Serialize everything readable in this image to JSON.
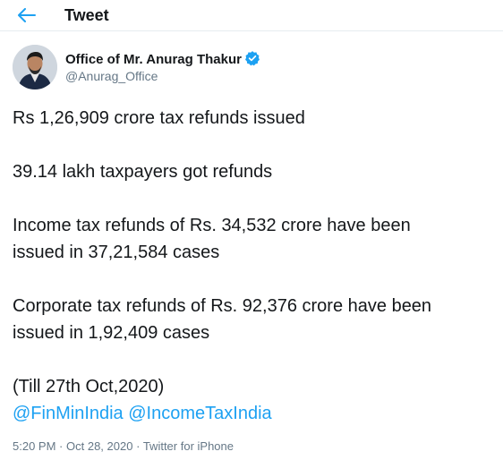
{
  "header": {
    "title": "Tweet",
    "back_icon": "arrow-left-icon",
    "accent_color": "#1da1f2"
  },
  "author": {
    "name": "Office of Mr. Anurag Thakur",
    "handle": "@Anurag_Office",
    "verified_icon": "verified-badge-icon"
  },
  "tweet": {
    "line1": "Rs 1,26,909 crore tax refunds issued",
    "line2": "39.14 lakh taxpayers got refunds",
    "line3a": "Income tax refunds of Rs. 34,532 crore have been",
    "line3b": "issued in 37,21,584 cases",
    "line4a": "Corporate tax refunds of Rs. 92,376 crore have been",
    "line4b": "issued in 1,92,409 cases",
    "line5": "(Till 27th Oct,2020)",
    "mention1": "@FinMinIndia",
    "mention2": "@IncomeTaxIndia"
  },
  "meta": {
    "time": "5:20 PM",
    "separator": "·",
    "date": "Oct 28, 2020",
    "source": "Twitter for iPhone"
  }
}
